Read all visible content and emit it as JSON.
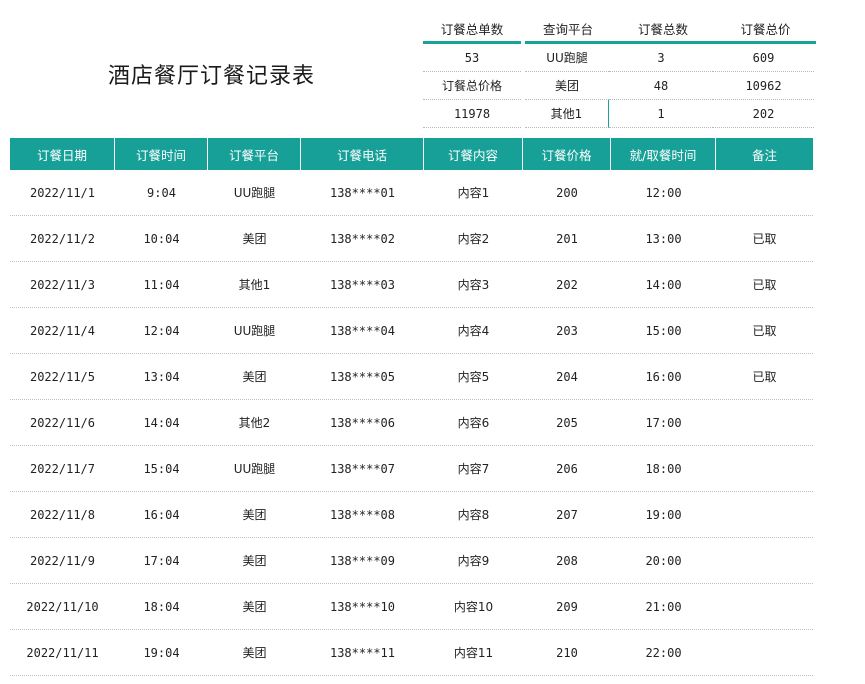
{
  "title": "酒店餐厅订餐记录表",
  "summary": {
    "headers": [
      "订餐总单数",
      "查询平台",
      "订餐总数",
      "订餐总价"
    ],
    "rows": [
      [
        "53",
        "UU跑腿",
        "3",
        "609"
      ],
      [
        "订餐总价格",
        "美团",
        "48",
        "10962"
      ],
      [
        "11978",
        "其他1",
        "1",
        "202"
      ]
    ]
  },
  "table": {
    "columns": [
      "订餐日期",
      "订餐时间",
      "订餐平台",
      "订餐电话",
      "订餐内容",
      "订餐价格",
      "就/取餐时间",
      "备注"
    ],
    "rows": [
      [
        "2022/11/1",
        "9:04",
        "UU跑腿",
        "138****01",
        "内容1",
        "200",
        "12:00",
        ""
      ],
      [
        "2022/11/2",
        "10:04",
        "美团",
        "138****02",
        "内容2",
        "201",
        "13:00",
        "已取"
      ],
      [
        "2022/11/3",
        "11:04",
        "其他1",
        "138****03",
        "内容3",
        "202",
        "14:00",
        "已取"
      ],
      [
        "2022/11/4",
        "12:04",
        "UU跑腿",
        "138****04",
        "内容4",
        "203",
        "15:00",
        "已取"
      ],
      [
        "2022/11/5",
        "13:04",
        "美团",
        "138****05",
        "内容5",
        "204",
        "16:00",
        "已取"
      ],
      [
        "2022/11/6",
        "14:04",
        "其他2",
        "138****06",
        "内容6",
        "205",
        "17:00",
        ""
      ],
      [
        "2022/11/7",
        "15:04",
        "UU跑腿",
        "138****07",
        "内容7",
        "206",
        "18:00",
        ""
      ],
      [
        "2022/11/8",
        "16:04",
        "美团",
        "138****08",
        "内容8",
        "207",
        "19:00",
        ""
      ],
      [
        "2022/11/9",
        "17:04",
        "美团",
        "138****09",
        "内容9",
        "208",
        "20:00",
        ""
      ],
      [
        "2022/11/10",
        "18:04",
        "美团",
        "138****10",
        "内容10",
        "209",
        "21:00",
        ""
      ],
      [
        "2022/11/11",
        "19:04",
        "美团",
        "138****11",
        "内容11",
        "210",
        "22:00",
        ""
      ]
    ]
  },
  "colors": {
    "accent": "#16a098",
    "header_text": "#ffffff"
  }
}
